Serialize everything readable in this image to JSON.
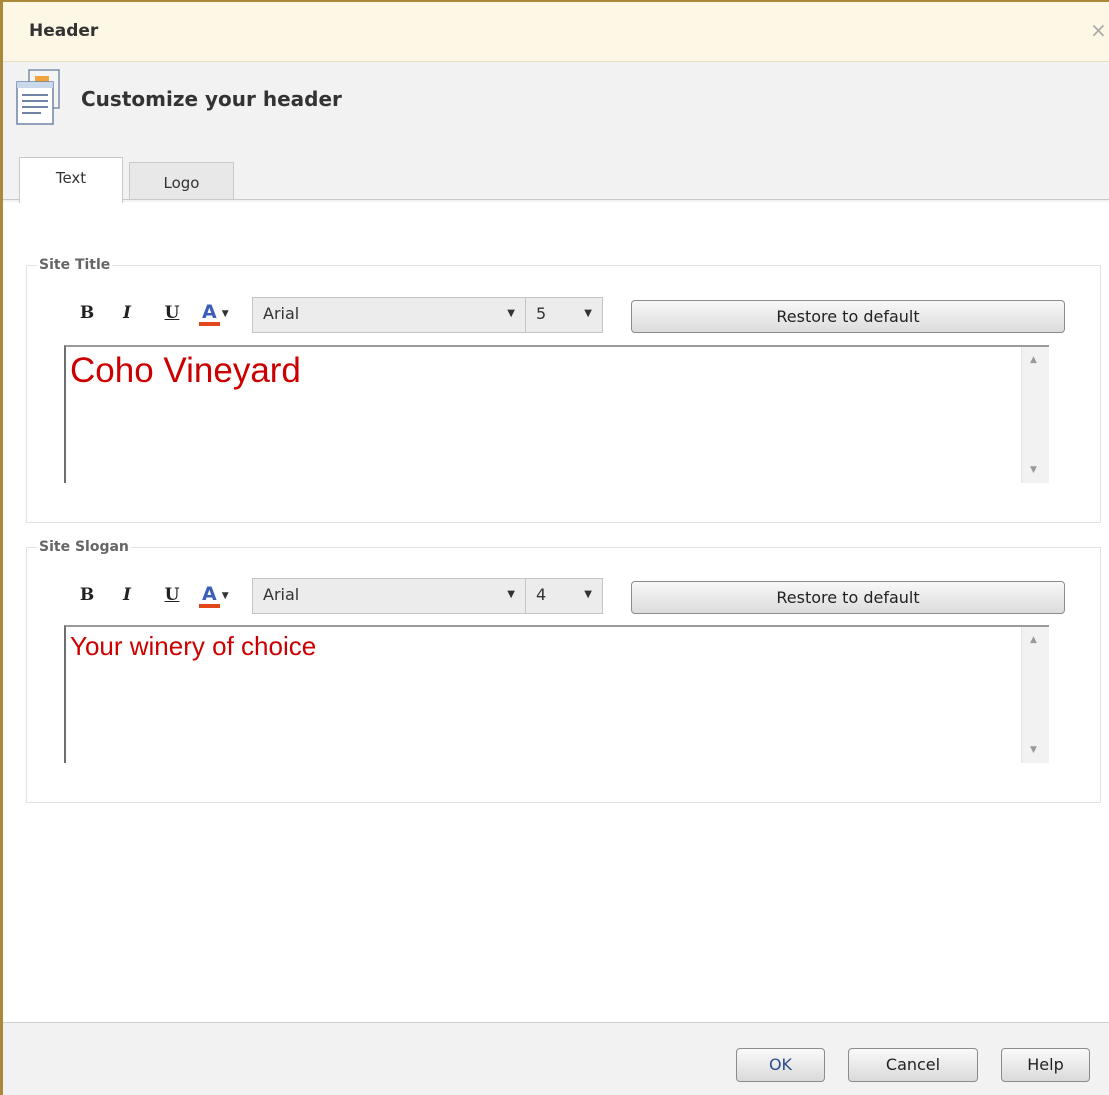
{
  "dialog": {
    "title": "Header",
    "close_glyph": "×"
  },
  "header": {
    "heading": "Customize your header",
    "icon": "document-icon"
  },
  "tabs": [
    {
      "label": "Text",
      "active": true
    },
    {
      "label": "Logo",
      "active": false
    }
  ],
  "site_title": {
    "legend": "Site Title",
    "toolbar": {
      "bold": "B",
      "italic": "I",
      "underline": "U",
      "font_color": "A"
    },
    "font": "Arial",
    "size": "5",
    "restore_label": "Restore to default",
    "content": "Coho Vineyard"
  },
  "site_slogan": {
    "legend": "Site Slogan",
    "toolbar": {
      "bold": "B",
      "italic": "I",
      "underline": "U",
      "font_color": "A"
    },
    "font": "Arial",
    "size": "4",
    "restore_label": "Restore to default",
    "content": "Your winery of choice"
  },
  "footer": {
    "ok_label": "OK",
    "cancel_label": "Cancel",
    "help_label": "Help"
  },
  "colors": {
    "text_red": "#cc0000",
    "titlebar_bg": "#fdf8e6",
    "dialog_border": "#a88a3a",
    "font_color_underline": "#e2471c"
  }
}
